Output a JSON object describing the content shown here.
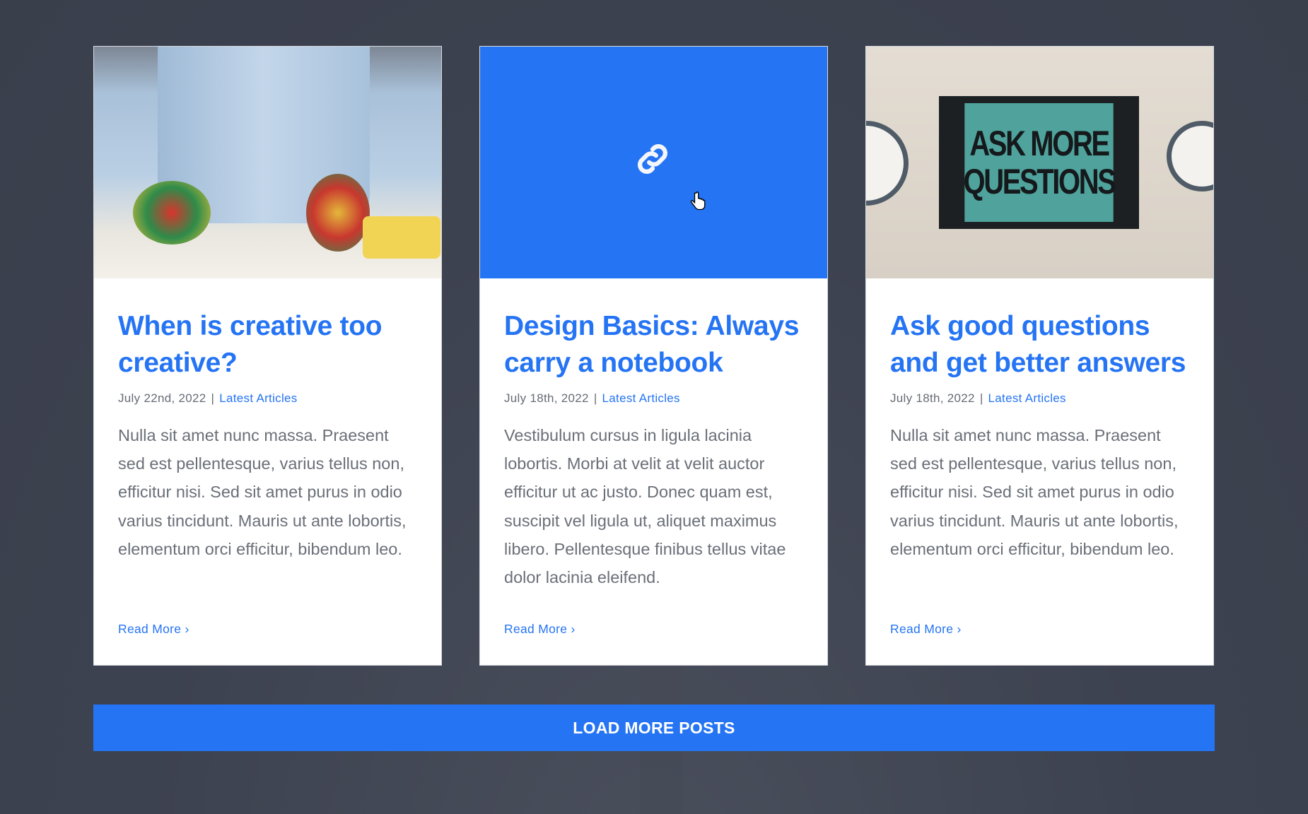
{
  "posts": [
    {
      "title": "When is creative too creative?",
      "date": "July 22nd, 2022",
      "category": "Latest Articles",
      "excerpt": "Nulla sit amet nunc massa. Praesent sed est pellentesque, varius tellus non, efficitur nisi. Sed sit amet purus in odio varius tincidunt. Mauris ut ante lobortis, elementum orci efficitur, bibendum leo.",
      "read_more": "Read More",
      "media": "photo"
    },
    {
      "title": "Design Basics: Always carry a notebook",
      "date": "July 18th, 2022",
      "category": "Latest Articles",
      "excerpt": "Vestibulum cursus in ligula lacinia lobortis. Morbi at velit at velit auctor efficitur ut ac justo. Donec quam est, suscipit vel ligula ut, aliquet maximus libero. Pellentesque finibus tellus vitae dolor lacinia eleifend.",
      "read_more": "Read More",
      "media": "link-icon"
    },
    {
      "title": "Ask good questions and get better answers",
      "date": "July 18th, 2022",
      "category": "Latest Articles",
      "excerpt": "Nulla sit amet nunc massa. Praesent sed est pellentesque, varius tellus non, efficitur nisi. Sed sit amet purus in odio varius tincidunt. Mauris ut ante lobortis, elementum orci efficitur, bibendum leo.",
      "read_more": "Read More",
      "media": "photo",
      "poster_line1": "ASK MORE",
      "poster_line2": "QUESTIONS"
    }
  ],
  "separator": "|",
  "chevron": "›",
  "load_more": "LOAD MORE POSTS",
  "colors": {
    "accent": "#2574f4",
    "background": "#3d4250"
  }
}
